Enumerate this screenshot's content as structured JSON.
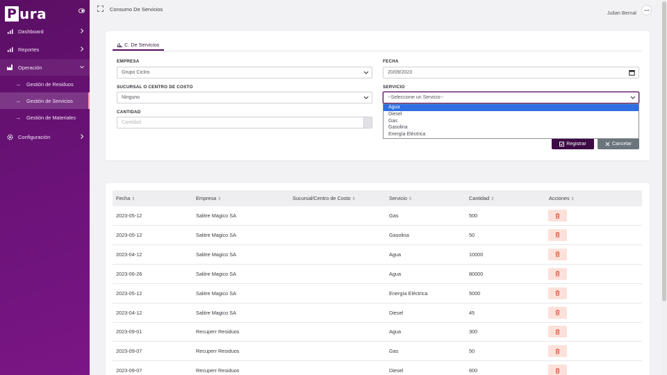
{
  "brand": {
    "letter": "P",
    "rest": "ura"
  },
  "sidebar": {
    "items": [
      {
        "label": "Dashboard",
        "icon": "bar-chart-icon"
      },
      {
        "label": "Reportes",
        "icon": "bar-chart-icon"
      },
      {
        "label": "Operación",
        "icon": "factory-icon"
      },
      {
        "label": "Configuración",
        "icon": "gear-icon"
      }
    ],
    "subitems": [
      {
        "label": "Gestión de Residuos"
      },
      {
        "label": "Gestión de Servicios"
      },
      {
        "label": "Gestión de Materiales"
      }
    ]
  },
  "header": {
    "title": "Consumo De Servicios",
    "user": "Julian Bernal"
  },
  "form": {
    "tab": "C. De Servicios",
    "empresa_label": "EMPRESA",
    "empresa_value": "Grupo Ciclos",
    "fecha_label": "FECHA",
    "fecha_value": "20/09/2023",
    "sucursal_label": "SUCURSAL O CENTRO DE COSTO",
    "sucursal_value": "Ninguno",
    "servicio_label": "SERVICIO",
    "servicio_value": "--Seleccione un Servicio--",
    "cantidad_label": "CANTIDAD",
    "cantidad_placeholder": "Cantidad",
    "servicio_options": [
      "Agua",
      "Diesel",
      "Gas",
      "Gasolina",
      "Energía Eléctrica"
    ],
    "registrar": "Registrar",
    "cancelar": "Cancelar"
  },
  "table": {
    "headers": [
      "Fecha",
      "Empresa",
      "Sucursal/Centro de Costo",
      "Servicio",
      "Cantidad",
      "Acciones"
    ],
    "sort_glyph": "⇕",
    "rows": [
      [
        "2023-05-12",
        "Salitre Magico SA",
        "",
        "Gas",
        "500"
      ],
      [
        "2023-05-12",
        "Salitre Magico SA",
        "",
        "Gasolina",
        "50"
      ],
      [
        "2023-04-12",
        "Salitre Magico SA",
        "",
        "Agua",
        "10000"
      ],
      [
        "2023-06-26",
        "Salitre Magico SA",
        "",
        "Agua",
        "80000"
      ],
      [
        "2023-05-12",
        "Salitre Magico SA",
        "",
        "Energía Eléctrica",
        "5000"
      ],
      [
        "2023-04-12",
        "Salitre Magico SA",
        "",
        "Diesel",
        "45"
      ],
      [
        "2023-09-01",
        "Recuperr Residuos",
        "",
        "Agua",
        "300"
      ],
      [
        "2023-09-07",
        "Recuperr Residuos",
        "",
        "Gas",
        "50"
      ],
      [
        "2023-09-07",
        "Recuperr Residuos",
        "",
        "Diesel",
        "600"
      ]
    ]
  },
  "colors": {
    "primary": "#5a0f63",
    "accent_dark": "#3d0a45",
    "delete_bg": "#fbe1d9",
    "delete_icon": "#e0533a",
    "selected_option": "#2f6fe3"
  }
}
